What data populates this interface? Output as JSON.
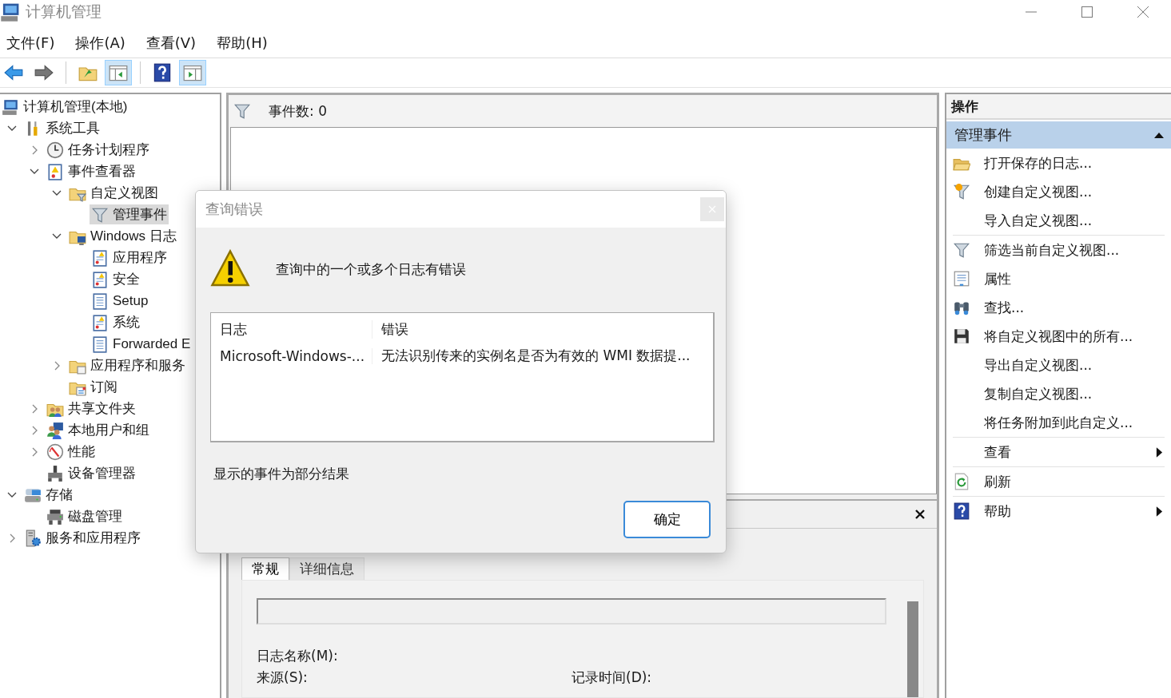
{
  "window": {
    "title": "计算机管理"
  },
  "menu": [
    "文件(F)",
    "操作(A)",
    "查看(V)",
    "帮助(H)"
  ],
  "toolbar": [
    [
      {
        "kind": "back",
        "selected": false
      },
      {
        "kind": "forward",
        "selected": false
      }
    ],
    [
      {
        "kind": "up",
        "selected": false
      },
      {
        "kind": "console-tree",
        "selected": true
      }
    ],
    [
      {
        "kind": "help",
        "selected": false
      },
      {
        "kind": "action-pane",
        "selected": true
      }
    ]
  ],
  "tree": [
    {
      "label": "计算机管理(本地)",
      "kind": "computer",
      "selected": false,
      "children": [
        {
          "label": "系统工具",
          "kind": "tools",
          "expanded": true,
          "selected": false,
          "children": [
            {
              "label": "任务计划程序",
              "kind": "clock",
              "expanded": false,
              "selected": false
            },
            {
              "label": "事件查看器",
              "kind": "eventlog",
              "expanded": true,
              "selected": false,
              "children": [
                {
                  "label": "自定义视图",
                  "kind": "folder-filter",
                  "expanded": true,
                  "selected": false,
                  "children": [
                    {
                      "label": "管理事件",
                      "kind": "filter",
                      "selected": true
                    }
                  ]
                },
                {
                  "label": "Windows 日志",
                  "kind": "folder-pc",
                  "expanded": true,
                  "selected": false,
                  "children": [
                    {
                      "label": "应用程序",
                      "kind": "log-warn",
                      "selected": false
                    },
                    {
                      "label": "安全",
                      "kind": "log-warn",
                      "selected": false
                    },
                    {
                      "label": "Setup",
                      "kind": "log",
                      "selected": false
                    },
                    {
                      "label": "系统",
                      "kind": "log-warn",
                      "selected": false
                    },
                    {
                      "label": "Forwarded E",
                      "kind": "log",
                      "selected": false
                    }
                  ]
                },
                {
                  "label": "应用程序和服务",
                  "kind": "folder-doc",
                  "expanded": false,
                  "selected": false
                },
                {
                  "label": "订阅",
                  "kind": "folder-cal",
                  "selected": false
                }
              ]
            },
            {
              "label": "共享文件夹",
              "kind": "share",
              "expanded": false,
              "selected": false
            },
            {
              "label": "本地用户和组",
              "kind": "users",
              "expanded": false,
              "selected": false
            },
            {
              "label": "性能",
              "kind": "perf",
              "expanded": false,
              "selected": false
            },
            {
              "label": "设备管理器",
              "kind": "device",
              "selected": false
            }
          ]
        },
        {
          "label": "存储",
          "kind": "storage",
          "expanded": true,
          "selected": false,
          "children": [
            {
              "label": "磁盘管理",
              "kind": "disk",
              "selected": false
            }
          ]
        },
        {
          "label": "服务和应用程序",
          "kind": "services",
          "expanded": false,
          "selected": false
        }
      ]
    }
  ],
  "events": {
    "count": "事件数: 0"
  },
  "details": {
    "tabs": [
      {
        "label": "常规",
        "selected": true
      },
      {
        "label": "详细信息",
        "selected": false
      }
    ],
    "fields": [
      "日志名称(M):",
      "来源(S):",
      "记录时间(D):"
    ]
  },
  "actions": {
    "title": "操作",
    "section": {
      "title": "管理事件",
      "expanded": true
    },
    "groups": [
      [
        {
          "label": "打开保存的日志...",
          "kind": "open-folder",
          "submenu": false
        },
        {
          "label": "创建自定义视图...",
          "kind": "funnel-star",
          "submenu": false
        },
        {
          "label": "导入自定义视图...",
          "kind": "plain",
          "submenu": false
        }
      ],
      [
        {
          "label": "筛选当前自定义视图...",
          "kind": "filter",
          "submenu": false
        },
        {
          "label": "属性",
          "kind": "properties",
          "submenu": false
        },
        {
          "label": "查找...",
          "kind": "binoculars",
          "submenu": false
        },
        {
          "label": "将自定义视图中的所有...",
          "kind": "save",
          "submenu": false
        },
        {
          "label": "导出自定义视图...",
          "kind": "plain",
          "submenu": false
        },
        {
          "label": "复制自定义视图...",
          "kind": "plain",
          "submenu": false
        },
        {
          "label": "将任务附加到此自定义...",
          "kind": "plain",
          "submenu": false
        }
      ],
      [
        {
          "label": "查看",
          "kind": "plain",
          "submenu": true
        }
      ],
      [
        {
          "label": "刷新",
          "kind": "refresh",
          "submenu": false
        }
      ],
      [
        {
          "label": "帮助",
          "kind": "help",
          "submenu": true
        }
      ]
    ]
  },
  "dialog": {
    "title": "查询错误",
    "message": "查询中的一个或多个日志有错误",
    "columns": [
      "日志",
      "错误"
    ],
    "rows": [
      [
        "Microsoft-Windows-...",
        "无法识别传来的实例名是否为有效的 WMI 数据提..."
      ]
    ],
    "note": "显示的事件为部分结果",
    "ok": "确定"
  }
}
